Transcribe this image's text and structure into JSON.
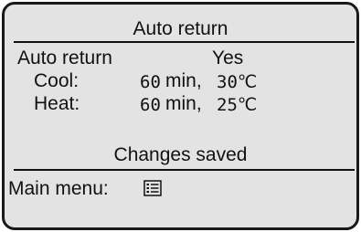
{
  "screen": {
    "title": "Auto return",
    "auto_return": {
      "label": "Auto return",
      "value": "Yes"
    },
    "cool": {
      "label": "Cool:",
      "minutes": "60",
      "min_unit": "min,",
      "temperature": "30℃"
    },
    "heat": {
      "label": "Heat:",
      "minutes": "60",
      "min_unit": "min,",
      "temperature": "25℃"
    },
    "status": "Changes saved",
    "footer": {
      "label": "Main menu:",
      "icon": "menu-list-icon"
    }
  },
  "colors": {
    "background": "#e3e3e3",
    "text": "#111111",
    "border": "#1a1a1a"
  }
}
